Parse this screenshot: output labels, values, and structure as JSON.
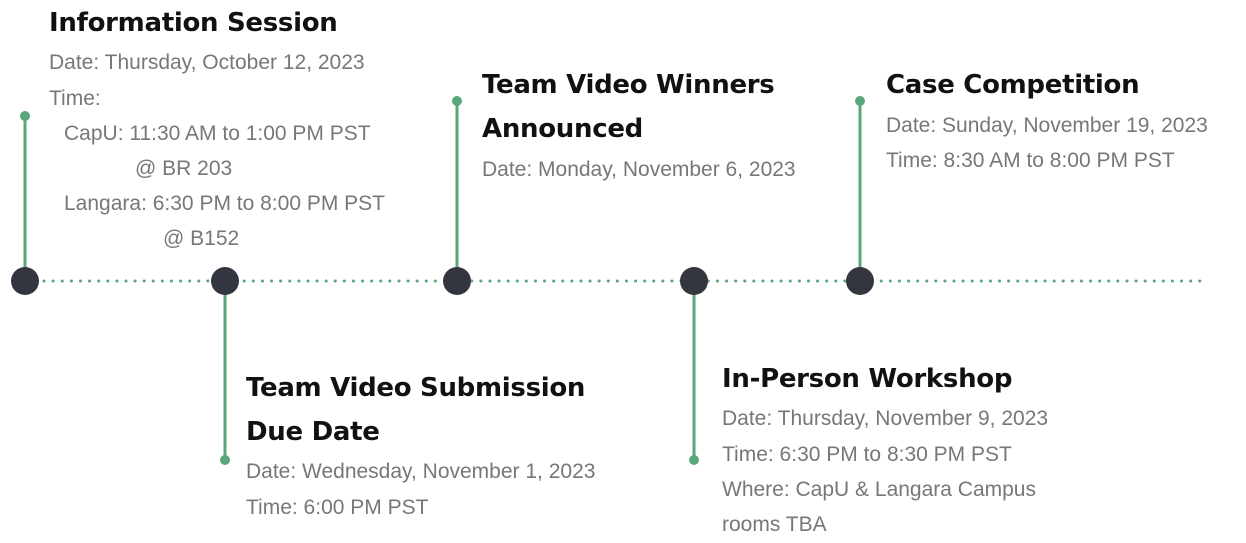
{
  "colors": {
    "connector": "#5aa77b",
    "dot": "#33353f",
    "dotted_axis": "#5aa77b",
    "title": "#111111",
    "detail": "#777777"
  },
  "events": [
    {
      "title": "Information Session",
      "details": [
        "Date: Thursday, October 12, 2023",
        "Time:",
        "CapU: 11:30 AM to 1:00 PM PST",
        "@ BR 203",
        "Langara: 6:30 PM to 8:00 PM PST",
        "@ B152"
      ]
    },
    {
      "title_lines": [
        "Team Video Submission",
        "Due Date"
      ],
      "details": [
        "Date: Wednesday, November 1, 2023",
        "Time: 6:00 PM PST"
      ]
    },
    {
      "title_lines": [
        "Team Video Winners",
        "Announced"
      ],
      "details": [
        "Date: Monday, November 6, 2023"
      ]
    },
    {
      "title": "In-Person Workshop",
      "details": [
        "Date: Thursday, November 9, 2023",
        "Time: 6:30 PM to 8:30 PM PST",
        "Where: CapU & Langara Campus",
        "rooms TBA"
      ]
    },
    {
      "title": "Case Competition",
      "details": [
        "Date: Sunday, November 19, 2023",
        "Time: 8:30 AM to 8:00 PM PST"
      ]
    }
  ]
}
